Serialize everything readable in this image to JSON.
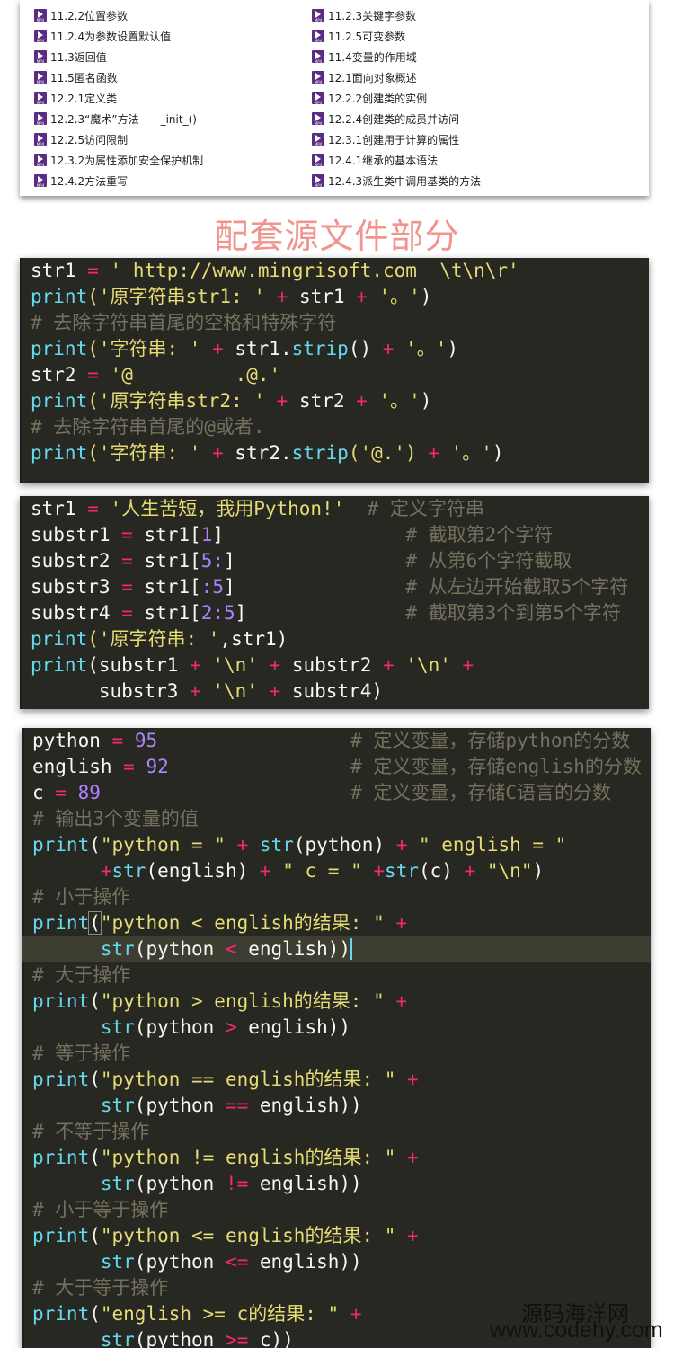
{
  "file_list": {
    "left": [
      "11.2.2位置参数",
      "11.2.4为参数设置默认值",
      "11.3返回值",
      "11.5匿名函数",
      "12.2.1定义类",
      "12.2.3“魔术”方法——_init_()",
      "12.2.5访问限制",
      "12.3.2为属性添加安全保护机制",
      "12.4.2方法重写"
    ],
    "right": [
      "11.2.3关键字参数",
      "11.2.5可变参数",
      "11.4变量的作用域",
      "12.1面向对象概述",
      "12.2.2创建类的实例",
      "12.2.4创建类的成员并访问",
      "12.3.1创建用于计算的属性",
      "12.4.1继承的基本语法",
      "12.4.3派生类中调用基类的方法"
    ],
    "icon": "mp4-video-icon"
  },
  "section_title": "配套源文件部分",
  "code1": {
    "l1": [
      "str1",
      "=",
      "' http://www.mingrisoft.com  \\t\\n\\r'"
    ],
    "l2": [
      "print",
      "('原字符串str1: ' ",
      "+",
      " str1 ",
      "+",
      " '。'",
      ")"
    ],
    "l3": "# 去除字符串首尾的空格和特殊字符",
    "l4": [
      "print",
      "('字符串: ' ",
      "+",
      " str1.",
      "strip",
      "() ",
      "+",
      " '。'",
      ")"
    ],
    "l5": [
      "str2",
      "=",
      "'@         .@.'"
    ],
    "l6": [
      "print",
      "('原字符串str2: ' ",
      "+",
      " str2 ",
      "+",
      " '。'",
      ")"
    ],
    "l7": "# 去除字符串首尾的@或者.",
    "l8": [
      "print",
      "('字符串: ' ",
      "+",
      " str2.",
      "strip",
      "('@.') ",
      "+",
      " '。'",
      ")"
    ]
  },
  "code2": {
    "l1": [
      "str1",
      "=",
      "'人生苦短，我用Python!'",
      "# 定义字符串"
    ],
    "l2": [
      "substr1",
      "=",
      "str1[",
      "1",
      "]",
      "# 截取第2个字符"
    ],
    "l3": [
      "substr2",
      "=",
      "str1[",
      "5:",
      "]",
      "# 从第6个字符截取"
    ],
    "l4": [
      "substr3",
      "=",
      "str1[",
      ":5",
      "]",
      "# 从左边开始截取5个字符"
    ],
    "l5": [
      "substr4",
      "=",
      "str1[",
      "2:5",
      "]",
      "# 截取第3个到第5个字符"
    ],
    "l6": [
      "print",
      "('原字符串: '",
      ",str1)"
    ],
    "l7": [
      "print",
      "(substr1 ",
      "+",
      " '\\n' ",
      "+",
      " substr2 ",
      "+",
      " '\\n' ",
      "+"
    ],
    "l8": [
      "substr3 ",
      "+",
      " '\\n' ",
      "+",
      " substr4)"
    ]
  },
  "code3": {
    "v1": [
      "python",
      "=",
      "95",
      "# 定义变量，存储python的分数"
    ],
    "v2": [
      "english",
      "=",
      "92",
      "# 定义变量，存储english的分数"
    ],
    "v3": [
      "c",
      "=",
      "89",
      "# 定义变量，存储C语言的分数"
    ],
    "c1": "# 输出3个变量的值",
    "p1a": [
      "print",
      "(",
      "\"python = \"",
      "+",
      "str",
      "(python)",
      "+",
      "\" english = \""
    ],
    "p1b": [
      "+",
      "str",
      "(english)",
      "+",
      "\" c = \"",
      "+",
      "str",
      "(c)",
      "+",
      "\"\\n\"",
      ")"
    ],
    "c2": "# 小于操作",
    "lt_a": [
      "print",
      "(",
      "\"python < english的结果: \"",
      "+"
    ],
    "lt_b": [
      "str",
      "(python ",
      "<",
      " english))"
    ],
    "c3": "# 大于操作",
    "gt_a": [
      "print",
      "(",
      "\"python > english的结果: \"",
      "+"
    ],
    "gt_b": [
      "str",
      "(python ",
      ">",
      " english))"
    ],
    "c4": "# 等于操作",
    "eq_a": [
      "print",
      "(",
      "\"python == english的结果: \"",
      "+"
    ],
    "eq_b": [
      "str",
      "(python ",
      "==",
      " english))"
    ],
    "c5": "# 不等于操作",
    "ne_a": [
      "print",
      "(",
      "\"python != english的结果: \"",
      "+"
    ],
    "ne_b": [
      "str",
      "(python ",
      "!=",
      " english))"
    ],
    "c6": "# 小于等于操作",
    "le_a": [
      "print",
      "(",
      "\"python <= english的结果: \"",
      "+"
    ],
    "le_b": [
      "str",
      "(python ",
      "<=",
      " english))"
    ],
    "c7": "# 大于等于操作",
    "ge_a": [
      "print",
      "(",
      "\"english >= c的结果: \"",
      "+"
    ],
    "ge_b": [
      "str",
      "(python ",
      ">=",
      " c))"
    ]
  },
  "watermark": {
    "cn": "源码海洋网",
    "en": "www.codehy.com"
  },
  "colors": {
    "editor_bg": "#272822",
    "keyword": "#66d9ef",
    "string": "#e6db74",
    "number": "#ae81ff",
    "operator": "#f92672",
    "comment": "#75715e",
    "title": "#f0948d"
  }
}
